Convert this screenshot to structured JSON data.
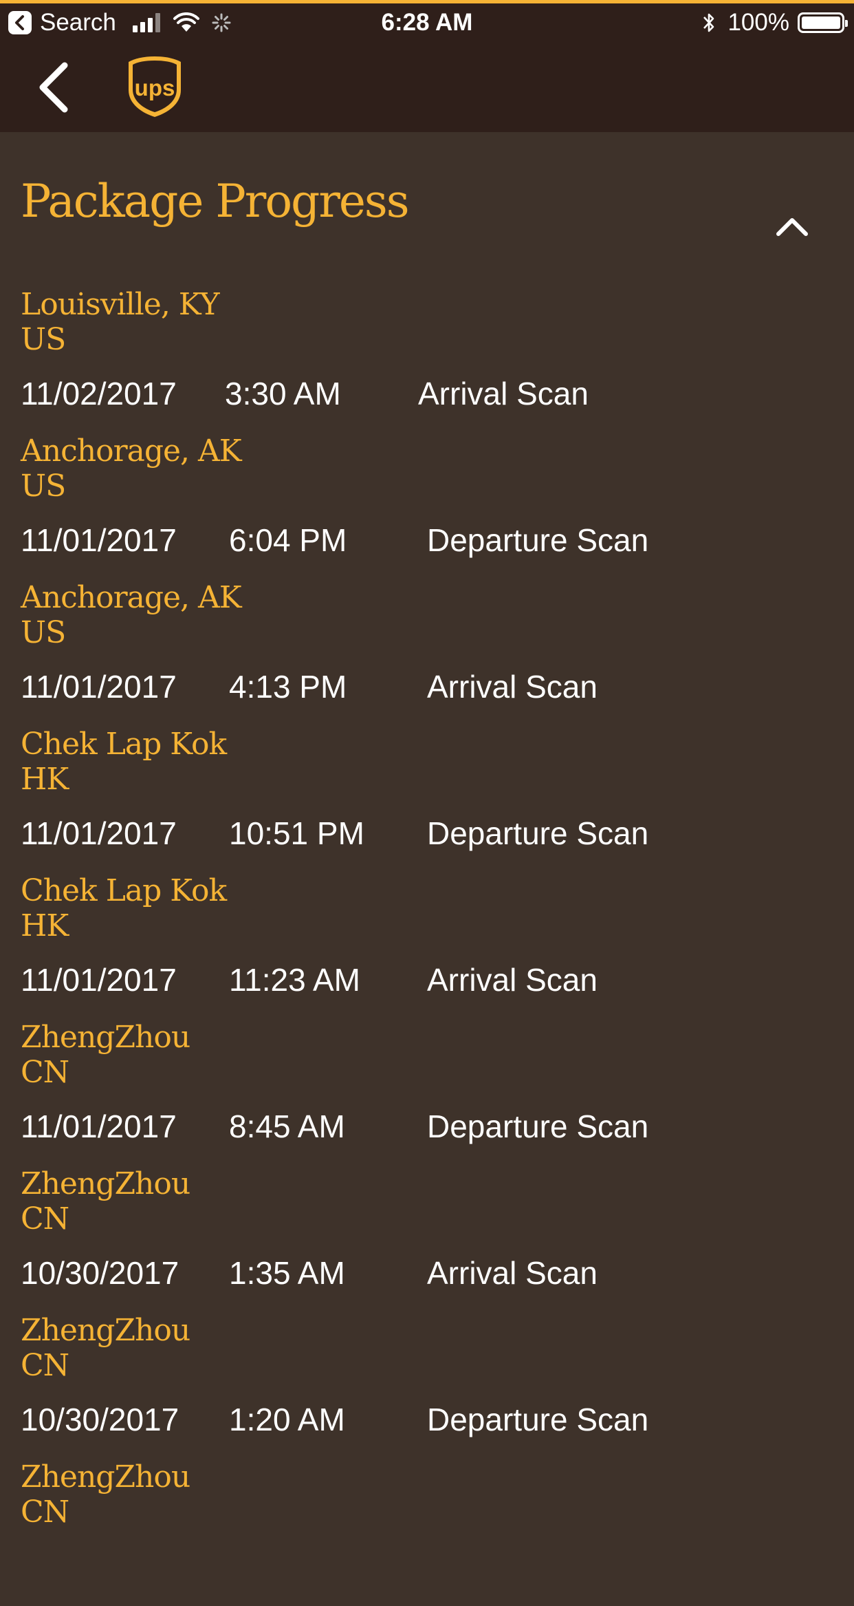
{
  "status_bar": {
    "back_app": "Search",
    "time": "6:28 AM",
    "battery": "100%"
  },
  "nav": {
    "logo_text": "ups",
    "brand_color": "#f5b335",
    "header_color": "#2f1f1a",
    "background_color": "#3e322a"
  },
  "section": {
    "title": "Package Progress"
  },
  "activities": [
    {
      "city": "Louisville, KY",
      "country": "US",
      "date": "11/02/2017",
      "time": "3:30 AM",
      "activity": "Arrival Scan"
    },
    {
      "city": "Anchorage, AK",
      "country": "US",
      "date": "11/01/2017",
      "time": "6:04 PM",
      "activity": "Departure Scan"
    },
    {
      "city": "Anchorage, AK",
      "country": "US",
      "date": "11/01/2017",
      "time": "4:13 PM",
      "activity": "Arrival Scan"
    },
    {
      "city": "Chek Lap Kok",
      "country": "HK",
      "date": "11/01/2017",
      "time": "10:51 PM",
      "activity": "Departure Scan"
    },
    {
      "city": "Chek Lap Kok",
      "country": "HK",
      "date": "11/01/2017",
      "time": "11:23 AM",
      "activity": "Arrival Scan"
    },
    {
      "city": "ZhengZhou",
      "country": "CN",
      "date": "11/01/2017",
      "time": "8:45 AM",
      "activity": "Departure Scan"
    },
    {
      "city": "ZhengZhou",
      "country": "CN",
      "date": "10/30/2017",
      "time": "1:35 AM",
      "activity": "Arrival Scan"
    },
    {
      "city": "ZhengZhou",
      "country": "CN",
      "date": "10/30/2017",
      "time": "1:20 AM",
      "activity": "Departure Scan"
    },
    {
      "city": "ZhengZhou",
      "country": "CN"
    }
  ]
}
